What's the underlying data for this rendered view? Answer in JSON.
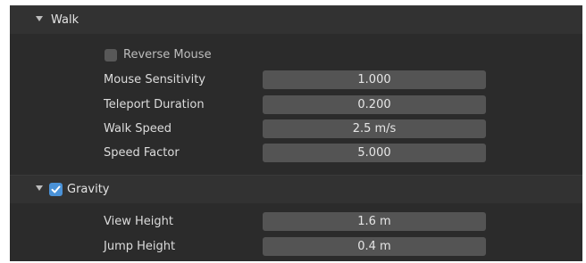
{
  "walk_panel": {
    "title": "Walk",
    "reverse_mouse": {
      "label": "Reverse Mouse",
      "checked": false
    },
    "fields": [
      {
        "label": "Mouse Sensitivity",
        "value": "1.000"
      },
      {
        "label": "Teleport Duration",
        "value": "0.200"
      },
      {
        "label": "Walk Speed",
        "value": "2.5 m/s"
      },
      {
        "label": "Speed Factor",
        "value": "5.000"
      }
    ]
  },
  "gravity_panel": {
    "title": "Gravity",
    "enabled": true,
    "fields": [
      {
        "label": "View Height",
        "value": "1.6 m"
      },
      {
        "label": "Jump Height",
        "value": "0.4 m"
      }
    ]
  },
  "icons": {
    "expand": "triangle-down-icon",
    "check": "checkmark-icon"
  },
  "colors": {
    "background": "#2b2b2b",
    "header": "#323232",
    "field": "#545454",
    "checkbox_on": "#4a92d8",
    "checkbox_off": "#585858"
  }
}
